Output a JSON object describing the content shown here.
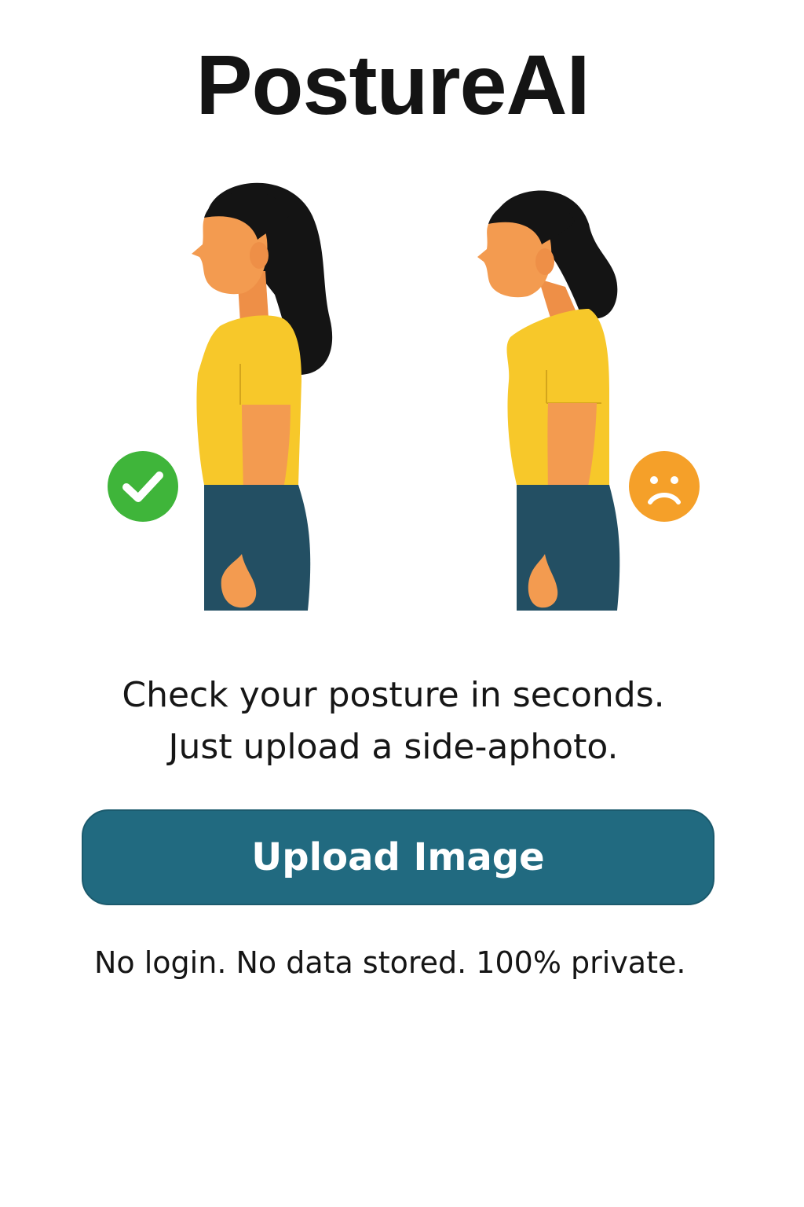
{
  "header": {
    "title": "PostureAI"
  },
  "illustration": {
    "good_badge_icon": "checkmark-icon",
    "bad_badge_icon": "sad-face-icon",
    "colors": {
      "good": "#3fb53a",
      "bad": "#f5a029",
      "skin": "#f39b50",
      "hair": "#141414",
      "shirt": "#f7c82a",
      "pants": "#234f63"
    }
  },
  "main": {
    "tagline_line1": "Check your posture in seconds.",
    "tagline_line2": "Just upload a side-aphoto.",
    "upload_button_label": "Upload Image",
    "privacy_note": "No login. No data stored. 100% private.",
    "button_color": "#216a80"
  }
}
